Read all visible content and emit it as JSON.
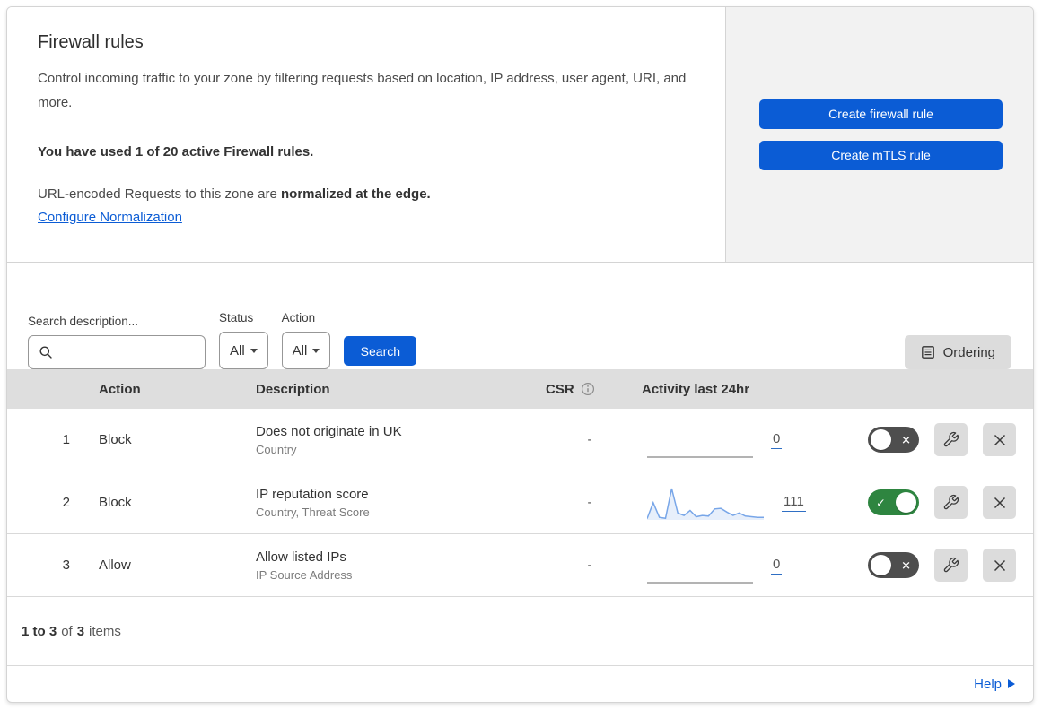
{
  "intro": {
    "heading": "Firewall rules",
    "description": "Control incoming traffic to your zone by filtering requests based on location, IP address, user agent, URI, and more.",
    "usage_notice": "You have used 1 of 20 active Firewall rules.",
    "normalization_prefix": "URL-encoded Requests to this zone are ",
    "normalization_bold": "normalized at the edge.",
    "normalization_link": "Configure Normalization"
  },
  "actions": {
    "create_firewall_rule": "Create firewall rule",
    "create_mtls_rule": "Create mTLS rule"
  },
  "filters": {
    "search_label": "Search description...",
    "search_value": "",
    "status": {
      "label": "Status",
      "selected": "All"
    },
    "action": {
      "label": "Action",
      "selected": "All"
    },
    "search_button": "Search",
    "ordering_button": "Ordering"
  },
  "table": {
    "headers": {
      "action": "Action",
      "description": "Description",
      "csr": "CSR",
      "activity": "Activity last 24hr"
    },
    "rows": [
      {
        "priority": "1",
        "action": "Block",
        "description": "Does not originate in UK",
        "match_fields": "Country",
        "csr": "-",
        "activity_count": "0",
        "enabled": false,
        "sparkline": [
          0,
          0,
          0,
          0,
          0,
          0,
          0,
          0,
          0,
          0
        ]
      },
      {
        "priority": "2",
        "action": "Block",
        "description": "IP reputation score",
        "match_fields": "Country, Threat Score",
        "csr": "-",
        "activity_count": "111",
        "enabled": true,
        "sparkline": [
          4,
          55,
          8,
          5,
          100,
          22,
          14,
          30,
          10,
          14,
          12,
          35,
          37,
          25,
          14,
          22,
          12,
          10,
          8,
          8
        ]
      },
      {
        "priority": "3",
        "action": "Allow",
        "description": "Allow listed IPs",
        "match_fields": "IP Source Address",
        "csr": "-",
        "activity_count": "0",
        "enabled": false,
        "sparkline": [
          0,
          0,
          0,
          0,
          0,
          0,
          0,
          0,
          0,
          0
        ]
      }
    ]
  },
  "pagination": {
    "range": "1 to 3",
    "of_text": "of",
    "total": "3",
    "items_text": "items"
  },
  "help": {
    "label": "Help"
  },
  "icons": {
    "check_glyph": "✓",
    "x_glyph": "✕",
    "search": "magnifier-icon",
    "ordering": "document-list-icon",
    "csr_info": "info-circle-icon",
    "rule_edit": "wrench-icon",
    "rule_delete": "x-icon",
    "help_arrow": "right-triangle-icon"
  },
  "colors": {
    "primary_blue": "#0b5cd5",
    "link_blue": "#0b5cd5",
    "toggle_on_green": "#2e8540",
    "toggle_off_gray": "#4e4e4e",
    "sparkline_blue": "#78a6e8",
    "sparkline_flat_gray": "#9a9a9a",
    "table_header_gray": "#dedede",
    "side_panel_gray": "#f2f2f2"
  }
}
